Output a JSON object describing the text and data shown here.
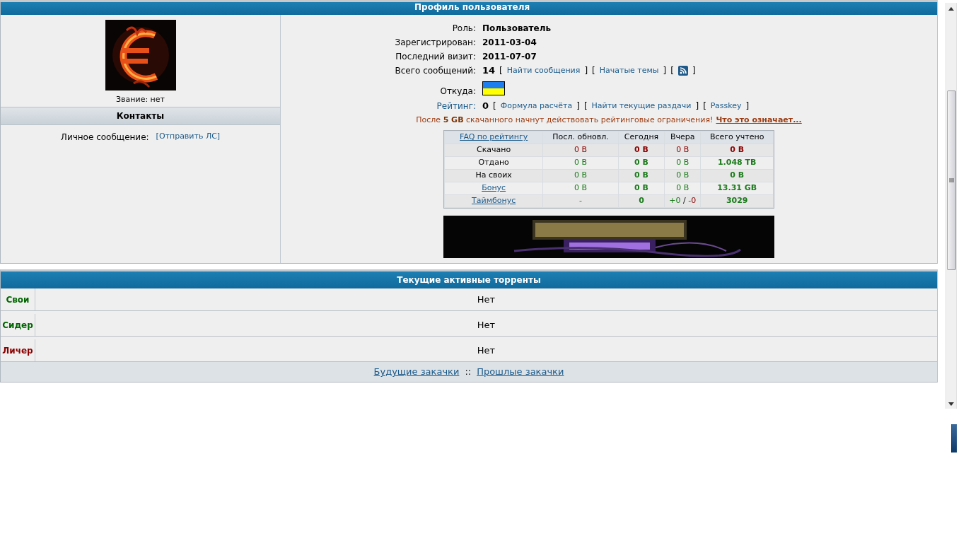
{
  "profile": {
    "title": "Профиль пользователя",
    "rank": "Звание: нет",
    "contacts": {
      "title": "Контакты",
      "label": "Личное сообщение:",
      "link": "[Отправить ЛС]"
    },
    "fields": [
      {
        "label": "Роль:",
        "value": "Пользователь"
      },
      {
        "label": "Зарегистрирован:",
        "value": "2011-03-04"
      },
      {
        "label": "Последний визит:",
        "value": "2011-07-07"
      }
    ],
    "posts": {
      "label": "Всего сообщений:",
      "value": "14",
      "links": [
        {
          "open": "[",
          "kind": "link",
          "text": "Найти сообщения",
          "close": "]"
        },
        {
          "open": "[",
          "kind": "link",
          "text": "Начатые темы",
          "close": "]"
        },
        {
          "open": "[",
          "kind": "rss",
          "close": "]"
        }
      ]
    },
    "from": {
      "label": "Откуда:"
    },
    "rating": {
      "label": "Рейтинг:",
      "value": "0",
      "links": [
        {
          "open": "[",
          "kind": "link",
          "text": "Формула расчёта",
          "close": "]"
        },
        {
          "open": "[",
          "kind": "link",
          "text": "Найти текущие раздачи",
          "close": "]"
        },
        {
          "open": "[",
          "kind": "link",
          "text": "Passkey",
          "close": "]"
        }
      ]
    },
    "notice": {
      "text": "После **5 GB** скачанного начнут действовать рейтинговые ограничения!",
      "link": "Что это означает..."
    },
    "stats": {
      "columns": [
        {
          "text": "FAQ по рейтингу",
          "kind": "link"
        },
        {
          "text": "Посл. обновл.",
          "kind": "label"
        },
        {
          "text": "Сегодня",
          "kind": "label"
        },
        {
          "text": "Вчера",
          "kind": "label"
        },
        {
          "text": "Всего учтено",
          "kind": "label"
        }
      ],
      "rows": [
        {
          "cells": [
            {
              "text": "Скачано",
              "kind": "label",
              "bold": false
            },
            {
              "text": "0 B",
              "kind": "down",
              "bold": false
            },
            {
              "text": "0 B",
              "kind": "down",
              "bold": true
            },
            {
              "text": "0 B",
              "kind": "down",
              "bold": false
            },
            {
              "text": "0 B",
              "kind": "down",
              "bold": true
            }
          ]
        },
        {
          "cells": [
            {
              "text": "Отдано",
              "kind": "label",
              "bold": false
            },
            {
              "text": "0 B",
              "kind": "up",
              "bold": false
            },
            {
              "text": "0 B",
              "kind": "up",
              "bold": true
            },
            {
              "text": "0 B",
              "kind": "up",
              "bold": false
            },
            {
              "text": "1.048 TB",
              "kind": "up",
              "bold": true
            }
          ]
        },
        {
          "cells": [
            {
              "text": "На своих",
              "kind": "label",
              "bold": false
            },
            {
              "text": "0 B",
              "kind": "up",
              "bold": false
            },
            {
              "text": "0 B",
              "kind": "up",
              "bold": true
            },
            {
              "text": "0 B",
              "kind": "up",
              "bold": false
            },
            {
              "text": "0 B",
              "kind": "up",
              "bold": true
            }
          ]
        },
        {
          "cells": [
            {
              "text": "Бонус",
              "kind": "link",
              "bold": false
            },
            {
              "text": "0 B",
              "kind": "up",
              "bold": false
            },
            {
              "text": "0 B",
              "kind": "up",
              "bold": true
            },
            {
              "text": "0 B",
              "kind": "up",
              "bold": false
            },
            {
              "text": "13.31 GB",
              "kind": "up",
              "bold": true
            }
          ]
        },
        {
          "cells": [
            {
              "text": "Таймбонус",
              "kind": "link",
              "bold": false
            },
            {
              "text": "-",
              "kind": "up",
              "bold": false
            },
            {
              "text": "0",
              "kind": "up",
              "bold": true
            },
            {
              "text": "+0 / -0",
              "kind": "mixed",
              "bold": false
            },
            {
              "text": "3029",
              "kind": "up",
              "bold": true
            }
          ]
        }
      ]
    }
  },
  "torrents": {
    "title": "Текущие активные торренты",
    "rows": [
      {
        "label": "Свои",
        "color": "#006400",
        "value": "Нет"
      },
      {
        "label": "Сидер",
        "color": "#006400",
        "value": "Нет"
      },
      {
        "label": "Личер",
        "color": "#8b0000",
        "value": "Нет"
      }
    ],
    "footer_links": [
      "Будущие закачки",
      "Прошлые закачки"
    ],
    "separator": "::"
  }
}
